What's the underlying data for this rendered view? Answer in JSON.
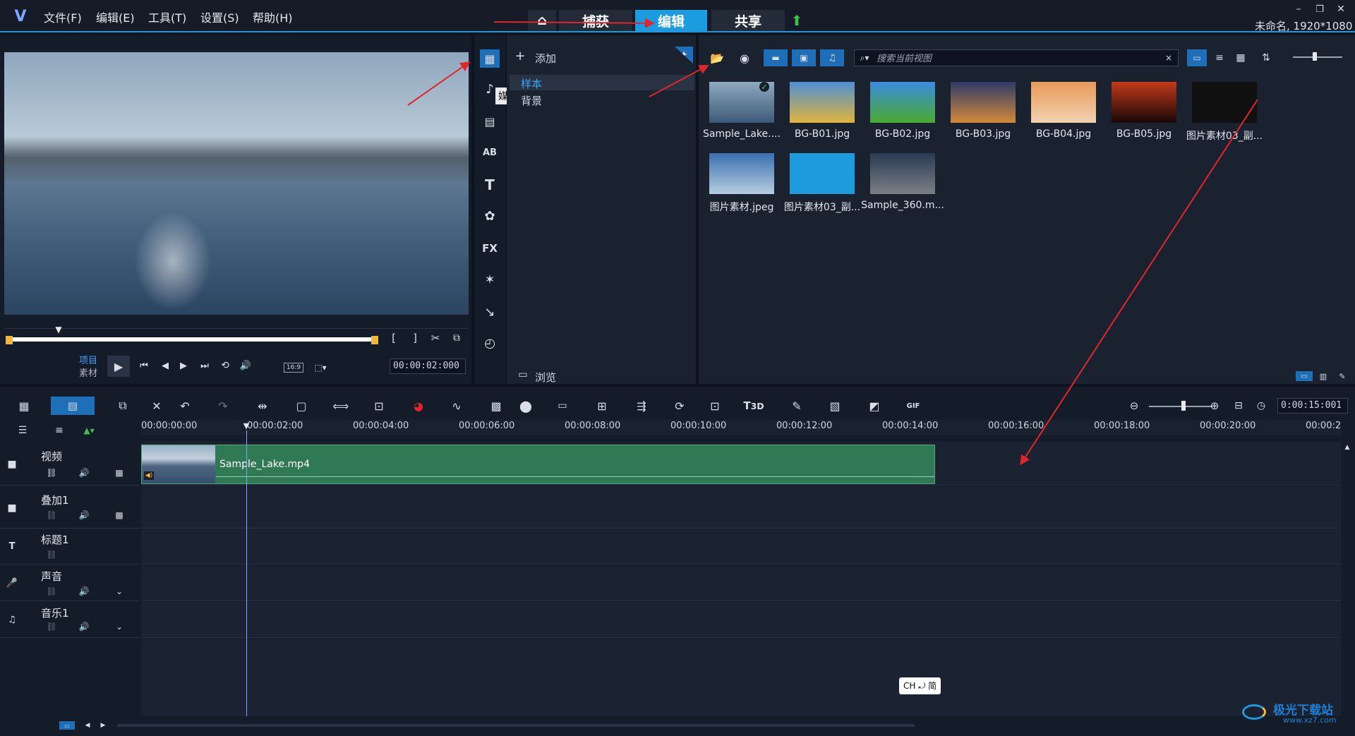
{
  "menu": {
    "file": "文件(F)",
    "edit": "编辑(E)",
    "tools": "工具(T)",
    "settings": "设置(S)",
    "help": "帮助(H)"
  },
  "tabs": {
    "capture": "捕获",
    "edit": "编辑",
    "share": "共享"
  },
  "window_info": "未命名, 1920*1080",
  "preview": {
    "project": "项目",
    "clip": "素材",
    "aspect": "16:9",
    "timecode": "00:00:02:000"
  },
  "library": {
    "add": "添加",
    "folders": [
      "样本",
      "背景"
    ],
    "media_tooltip": "媒体",
    "browse": "浏览",
    "search_placeholder": "搜索当前视图"
  },
  "media": [
    {
      "name": "Sample_Lake....",
      "colors": [
        "#8fa9c0",
        "#3c5a78"
      ]
    },
    {
      "name": "BG-B01.jpg",
      "colors": [
        "#4f8fd6",
        "#e0b43a"
      ]
    },
    {
      "name": "BG-B02.jpg",
      "colors": [
        "#3b8be0",
        "#4caa2e"
      ]
    },
    {
      "name": "BG-B03.jpg",
      "colors": [
        "#2e3a6a",
        "#d28a3a"
      ]
    },
    {
      "name": "BG-B04.jpg",
      "colors": [
        "#e89a5a",
        "#f2d2b0"
      ]
    },
    {
      "name": "BG-B05.jpg",
      "colors": [
        "#c23a1a",
        "#180606"
      ]
    },
    {
      "name": "图片素材03_副...",
      "colors": [
        "#101010",
        "#101010"
      ]
    },
    {
      "name": "图片素材.jpeg",
      "colors": [
        "#3a6fb0",
        "#b6cde0"
      ]
    },
    {
      "name": "图片素材03_副...",
      "colors": [
        "#1e9bdc",
        "#1e9bdc"
      ]
    },
    {
      "name": "Sample_360.m...",
      "colors": [
        "#2b3a52",
        "#7a7f86"
      ]
    }
  ],
  "timeline": {
    "ticks": [
      "00:00:00:00",
      "00:00:02:00",
      "00:00:04:00",
      "00:00:06:00",
      "00:00:08:00",
      "00:00:10:00",
      "00:00:12:00",
      "00:00:14:00",
      "00:00:16:00",
      "00:00:18:00",
      "00:00:20:00",
      "00:00:2"
    ],
    "zoom_time": "0:00:15:001",
    "tracks": [
      "视频",
      "叠加1",
      "标题1",
      "声音",
      "音乐1"
    ],
    "clip_name": "Sample_Lake.mp4"
  },
  "ime": "CH ⤾ 简",
  "watermark": {
    "text": "极光下载站",
    "url": "www.xz7.com"
  }
}
